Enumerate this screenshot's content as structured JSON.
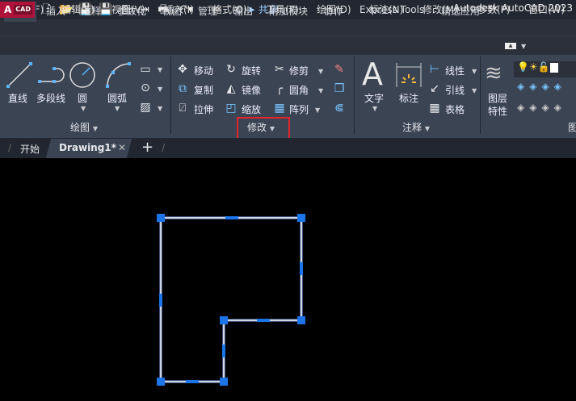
{
  "app": {
    "logo_text": "A",
    "logo_sub": "CAD",
    "title": "Autodesk AutoCAD 2023",
    "share": "共享"
  },
  "quick_access": [
    "new-icon",
    "open-icon",
    "save-icon",
    "save-as-icon",
    "open-sheet-icon",
    "publish-icon",
    "plot-icon",
    "undo-icon",
    "redo-icon",
    "customize-icon"
  ],
  "menu": [
    "文件(F)",
    "编辑(E)",
    "视图(V)",
    "插入(I)",
    "格式(O)",
    "工具(T)",
    "绘图(D)",
    "标注(N)",
    "修改(M)",
    "参数(P)",
    "窗口(W)"
  ],
  "ribbon_tabs": [
    "默认",
    "插入",
    "注释",
    "参数化",
    "视图",
    "管理",
    "输出",
    "附加模块",
    "协作",
    "Express Tools",
    "精选应用"
  ],
  "active_tab": "默认",
  "panels": {
    "draw": {
      "title": "绘图",
      "tools": [
        "直线",
        "多段线",
        "圆",
        "圆弧"
      ]
    },
    "modify": {
      "title": "修改",
      "tools": [
        "移动",
        "旋转",
        "修剪",
        "复制",
        "镜像",
        "圆角",
        "拉伸",
        "缩放",
        "阵列"
      ]
    },
    "annotation": {
      "title": "注释",
      "tools": [
        "文字",
        "标注",
        "线性",
        "引线",
        "表格"
      ]
    },
    "layers": {
      "title": "图",
      "tools": [
        "图层",
        "特性"
      ]
    }
  },
  "doc_tabs": [
    "开始",
    "Drawing1*"
  ],
  "active_doc": "Drawing1*",
  "colors": {
    "accent": "#1b74e8",
    "highlight": "#e0262b",
    "ribbon": "#3b4453"
  }
}
